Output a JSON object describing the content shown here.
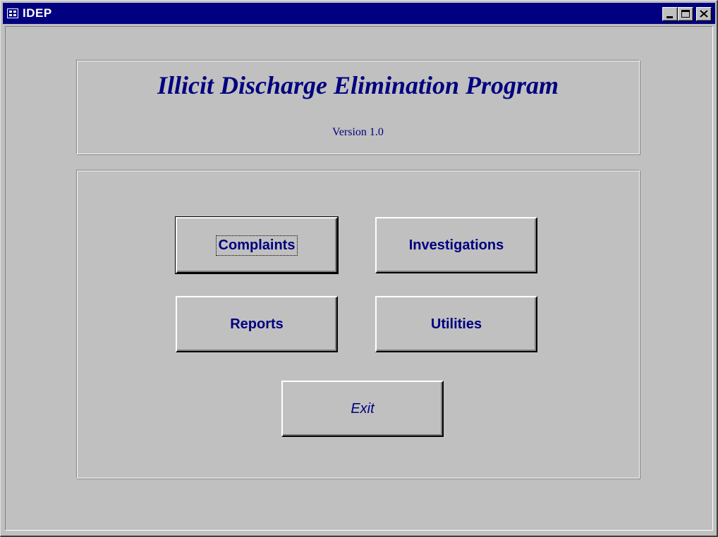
{
  "window": {
    "title": "IDEP",
    "controls": {
      "minimize": "minimize",
      "maximize": "maximize",
      "close": "close"
    }
  },
  "header": {
    "title": "Illicit Discharge Elimination Program",
    "version": "Version 1.0"
  },
  "buttons": {
    "complaints": "Complaints",
    "investigations": "Investigations",
    "reports": "Reports",
    "utilities": "Utilities",
    "exit": "Exit"
  },
  "colors": {
    "titlebar": "#000080",
    "text_accent": "#000080",
    "face": "#c0c0c0"
  },
  "icons": {
    "system_menu": "form-icon",
    "minimize": "minimize-icon",
    "maximize": "maximize-icon",
    "close": "close-icon"
  }
}
